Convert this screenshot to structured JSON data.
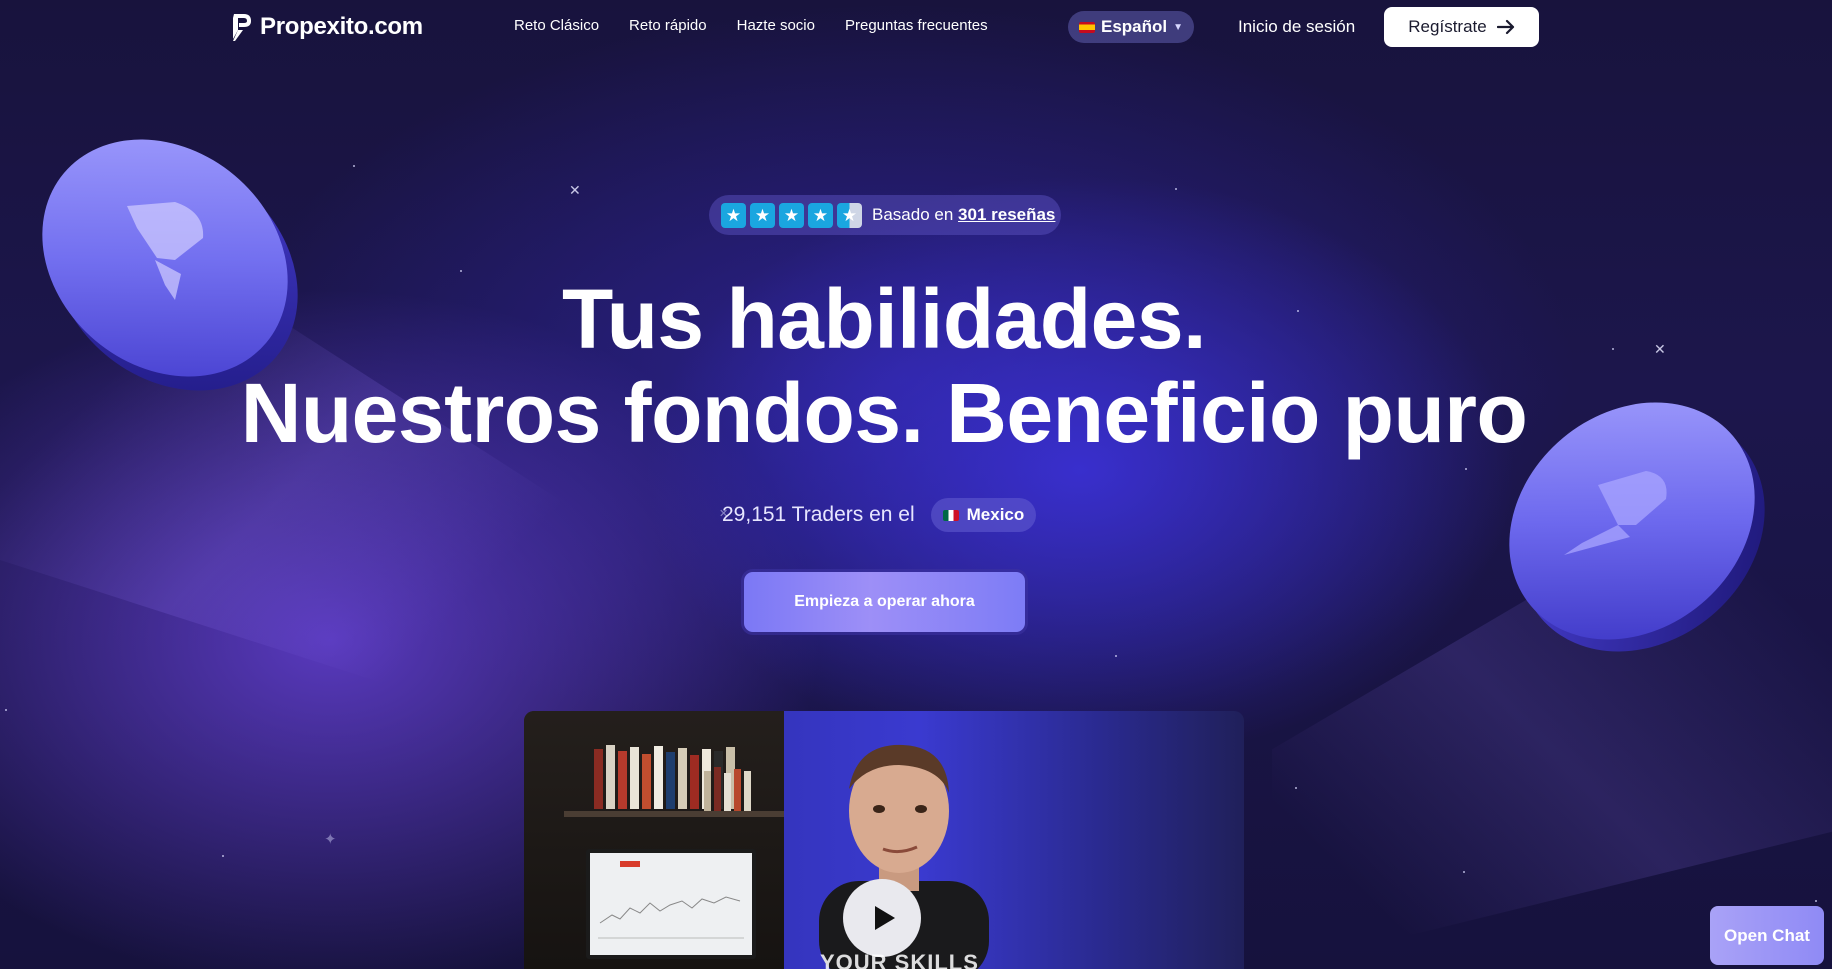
{
  "nav": {
    "logo_text": "Propexito.com",
    "links": [
      "Reto Clásico",
      "Reto rápido",
      "Hazte socio",
      "Preguntas frecuentes"
    ],
    "language": "Español",
    "login": "Inicio de sesión",
    "register": "Regístrate"
  },
  "rating": {
    "stars": 4.5,
    "prefix": "Basado en",
    "link": "301 reseñas",
    "star_color": "#1aa6e0"
  },
  "hero": {
    "headline_line1": "Tus habilidades.",
    "headline_line2": "Nuestros fondos. Beneficio puro",
    "traders_text": "29,151 Traders en el",
    "country": "Mexico",
    "cta": "Empieza a operar ahora"
  },
  "video": {
    "caption": "YOUR SKILLS"
  },
  "chat": {
    "label": "Open Chat"
  },
  "colors": {
    "accent": "#7b78f5",
    "background": "#18133d",
    "coin": "#6f6af0"
  }
}
